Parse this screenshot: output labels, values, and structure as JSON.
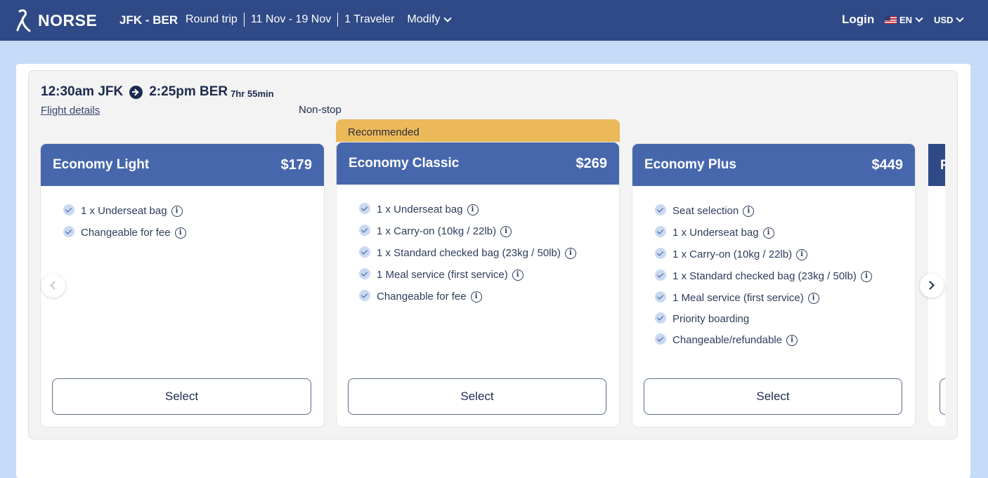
{
  "header": {
    "logo_text": "NORSE",
    "route": "JFK - BER",
    "trip_type": "Round trip",
    "dates": "11 Nov - 19 Nov",
    "travelers": "1 Traveler",
    "modify_label": "Modify",
    "login_label": "Login",
    "language": "EN",
    "currency": "USD"
  },
  "flight": {
    "departure": "12:30am JFK",
    "arrival": "2:25pm BER",
    "duration": "7hr 55min",
    "details_link": "Flight details",
    "stops": "Non-stop"
  },
  "recommended_label": "Recommended",
  "fares": [
    {
      "name": "Economy Light",
      "price": "$179",
      "features": [
        "1 x Underseat bag",
        "Changeable for fee"
      ],
      "select_label": "Select"
    },
    {
      "name": "Economy Classic",
      "price": "$269",
      "features": [
        "1 x Underseat bag",
        "1 x Carry-on (10kg / 22lb)",
        "1 x Standard checked bag (23kg / 50lb)",
        "1 Meal service (first service)",
        "Changeable for fee"
      ],
      "select_label": "Select"
    },
    {
      "name": "Economy Plus",
      "price": "$449",
      "features": [
        "Seat selection",
        "1 x Underseat bag",
        "1 x Carry-on (10kg / 22lb)",
        "1 x Standard checked bag (23kg / 50lb)",
        "1 Meal service (first service)",
        "Priority boarding",
        "Changeable/refundable"
      ],
      "select_label": "Select"
    },
    {
      "name": "P"
    }
  ],
  "colors": {
    "header_bg": "#2f4a86",
    "card_header": "#4767ad",
    "recommended": "#ebb95a",
    "page_bg": "#c6dbf7"
  }
}
